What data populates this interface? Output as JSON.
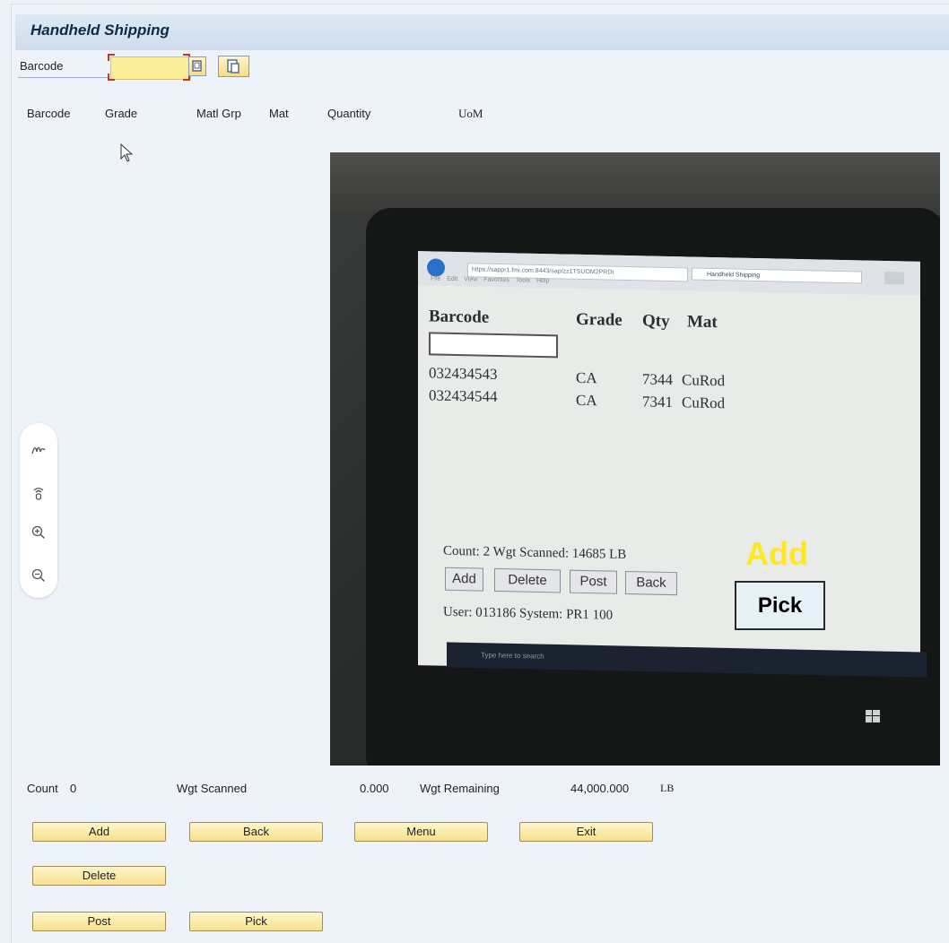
{
  "screen": {
    "title": "Handheld Shipping",
    "barcode_label": "Barcode",
    "barcode_value": "",
    "columns": [
      "Barcode",
      "Grade",
      "Matl Grp",
      "Mat",
      "Quantity",
      "UoM"
    ]
  },
  "footer": {
    "count_label": "Count",
    "count_value": "0",
    "wgt_scanned_label": "Wgt Scanned",
    "wgt_scanned_value": "0.000",
    "wgt_remaining_label": "Wgt Remaining",
    "wgt_remaining_value": "44,000.000",
    "wgt_unit": "LB"
  },
  "buttons": {
    "add": "Add",
    "back": "Back",
    "menu": "Menu",
    "exit": "Exit",
    "delete": "Delete",
    "post": "Post",
    "pick": "Pick"
  },
  "side_tools": [
    "pen-icon",
    "broadcast-icon",
    "zoom-in-icon",
    "zoom-out-icon"
  ],
  "photo": {
    "browser_url": "https://sappr1.fmi.com:8443/sap/zz1TSUOM2PRDt",
    "browser_tab": "Handheld Shipping",
    "menu_items": "File Edit View Favorites Tools Help",
    "headers": {
      "barcode": "Barcode",
      "grade": "Grade",
      "qty": "Qty",
      "mat": "Mat"
    },
    "rows": [
      {
        "barcode": "032434543",
        "grade": "CA",
        "qty": "7344",
        "mat": "CuRod"
      },
      {
        "barcode": "032434544",
        "grade": "CA",
        "qty": "7341",
        "mat": "CuRod"
      }
    ],
    "status_line": "Count: 2   Wgt Scanned: 14685 LB",
    "buttons": [
      "Add",
      "Delete",
      "Post",
      "Back"
    ],
    "user_line": "User: 013186 System: PR1 100",
    "taskbar_search": "Type here to search"
  },
  "overlay": {
    "add_caption": "Add",
    "pick_caption": "Pick"
  },
  "colors": {
    "background": "#edf2f8",
    "button_yellow": "#f8e08c",
    "overlay_yellow": "#ffe81c"
  }
}
